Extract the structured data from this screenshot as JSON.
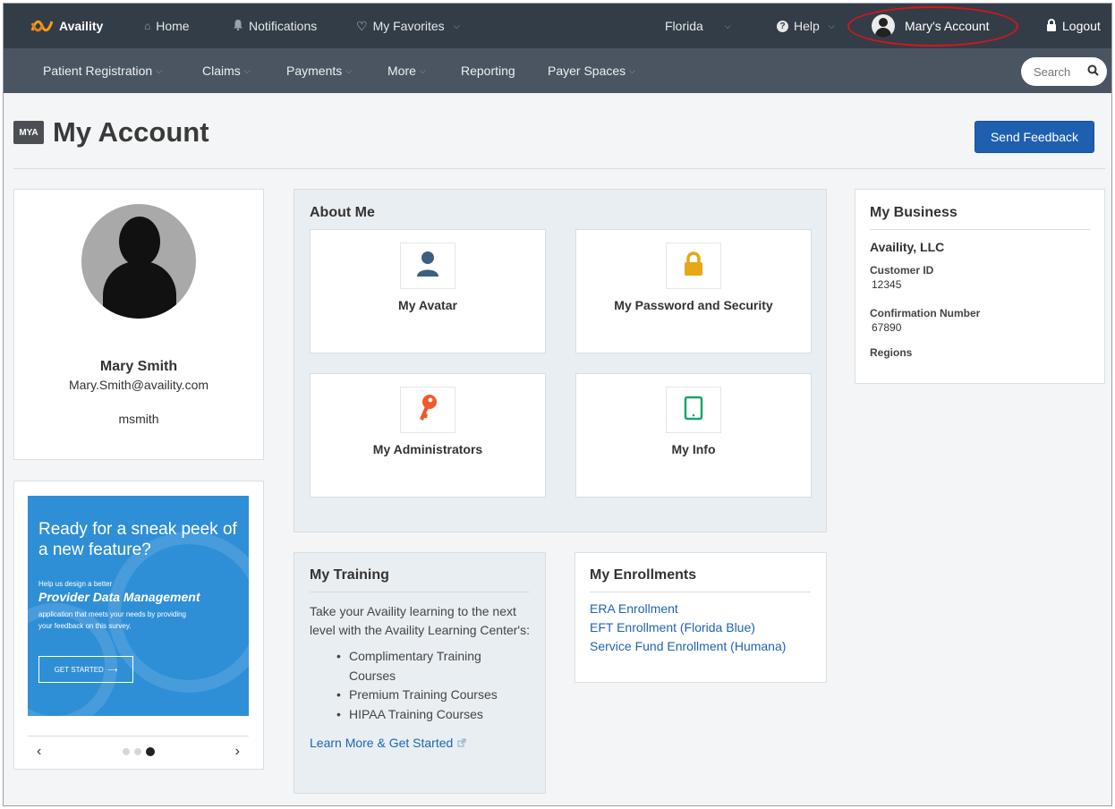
{
  "topbar": {
    "logo": "Availity",
    "home": "Home",
    "notifications": "Notifications",
    "favorites": "My Favorites",
    "region": "Florida",
    "help": "Help",
    "account": "Mary's Account",
    "logout": "Logout"
  },
  "subnav": {
    "items": [
      "Patient Registration",
      "Claims",
      "Payments",
      "More",
      "Reporting",
      "Payer Spaces"
    ],
    "search_placeholder": "Search"
  },
  "page": {
    "badge": "MYA",
    "title": "My Account",
    "feedback": "Send Feedback"
  },
  "profile": {
    "name": "Mary Smith",
    "email": "Mary.Smith@availity.com",
    "username": "msmith"
  },
  "promo": {
    "headline": "Ready for a sneak peek of a new feature?",
    "line1": "Help us design a better",
    "product": "Provider Data Management",
    "line2": "application that meets your needs by providing your feedback on this survey.",
    "button": "GET STARTED",
    "prev": "‹",
    "next": "›"
  },
  "about": {
    "title": "About Me",
    "tiles": [
      "My Avatar",
      "My Password and Security",
      "My Administrators",
      "My Info"
    ]
  },
  "training": {
    "title": "My Training",
    "body": "Take your Availity learning to the next level with the Availity Learning Center's:",
    "items": [
      "Complimentary Training Courses",
      "Premium Training Courses",
      "HIPAA Training Courses"
    ],
    "link": "Learn More & Get Started"
  },
  "enrollments": {
    "title": "My Enrollments",
    "links": [
      "ERA Enrollment",
      "EFT Enrollment (Florida Blue)",
      "Service Fund Enrollment (Humana)"
    ]
  },
  "business": {
    "title": "My Business",
    "company": "Availity, LLC",
    "customer_id_label": "Customer ID",
    "customer_id": "12345",
    "confirmation_label": "Confirmation Number",
    "confirmation": "67890",
    "regions_label": "Regions"
  },
  "colors": {
    "topbar": "#333d47",
    "subnav": "#4a5561",
    "primary_button": "#1f5fb0",
    "link": "#1f63b5",
    "account_highlight": "#d8141c",
    "promo": "#2f8fd6"
  }
}
